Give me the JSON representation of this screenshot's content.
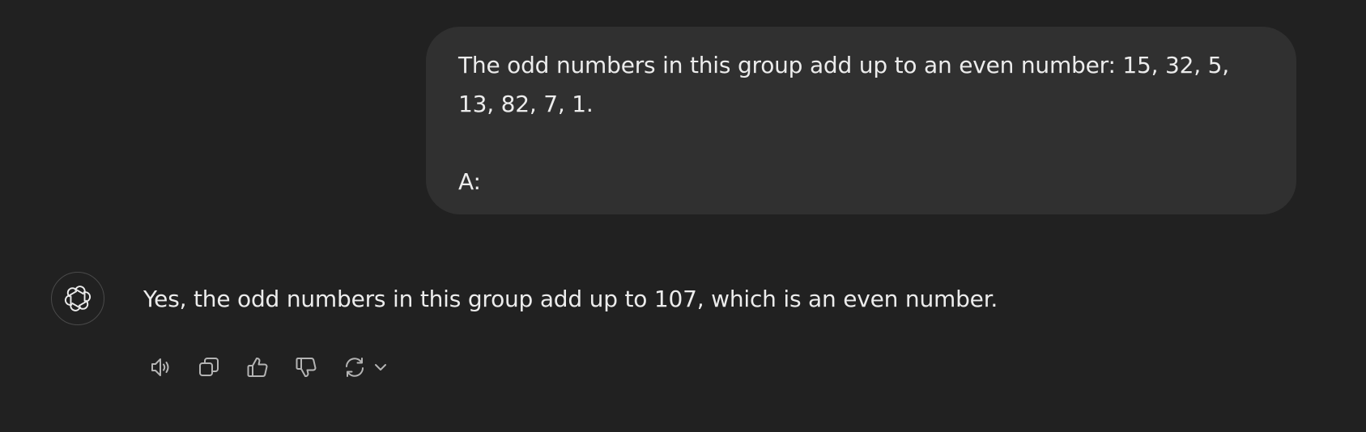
{
  "user_message": {
    "lines": [
      "The odd numbers in this group add up to an even number: 15, 32, 5,",
      "13, 82, 7, 1.",
      "",
      "A:"
    ]
  },
  "assistant_message": {
    "avatar_icon": "openai-logo-icon",
    "text": "Yes, the odd numbers in this group add up to 107, which is an even number."
  },
  "actions": [
    {
      "icon": "speaker-icon"
    },
    {
      "icon": "copy-icon"
    },
    {
      "icon": "thumbs-up-icon"
    },
    {
      "icon": "thumbs-down-icon"
    },
    {
      "icon": "regenerate-icon"
    }
  ],
  "colors": {
    "background": "#212121",
    "bubble": "#303030",
    "text": "#ececec",
    "icon": "#b4b4b4"
  }
}
